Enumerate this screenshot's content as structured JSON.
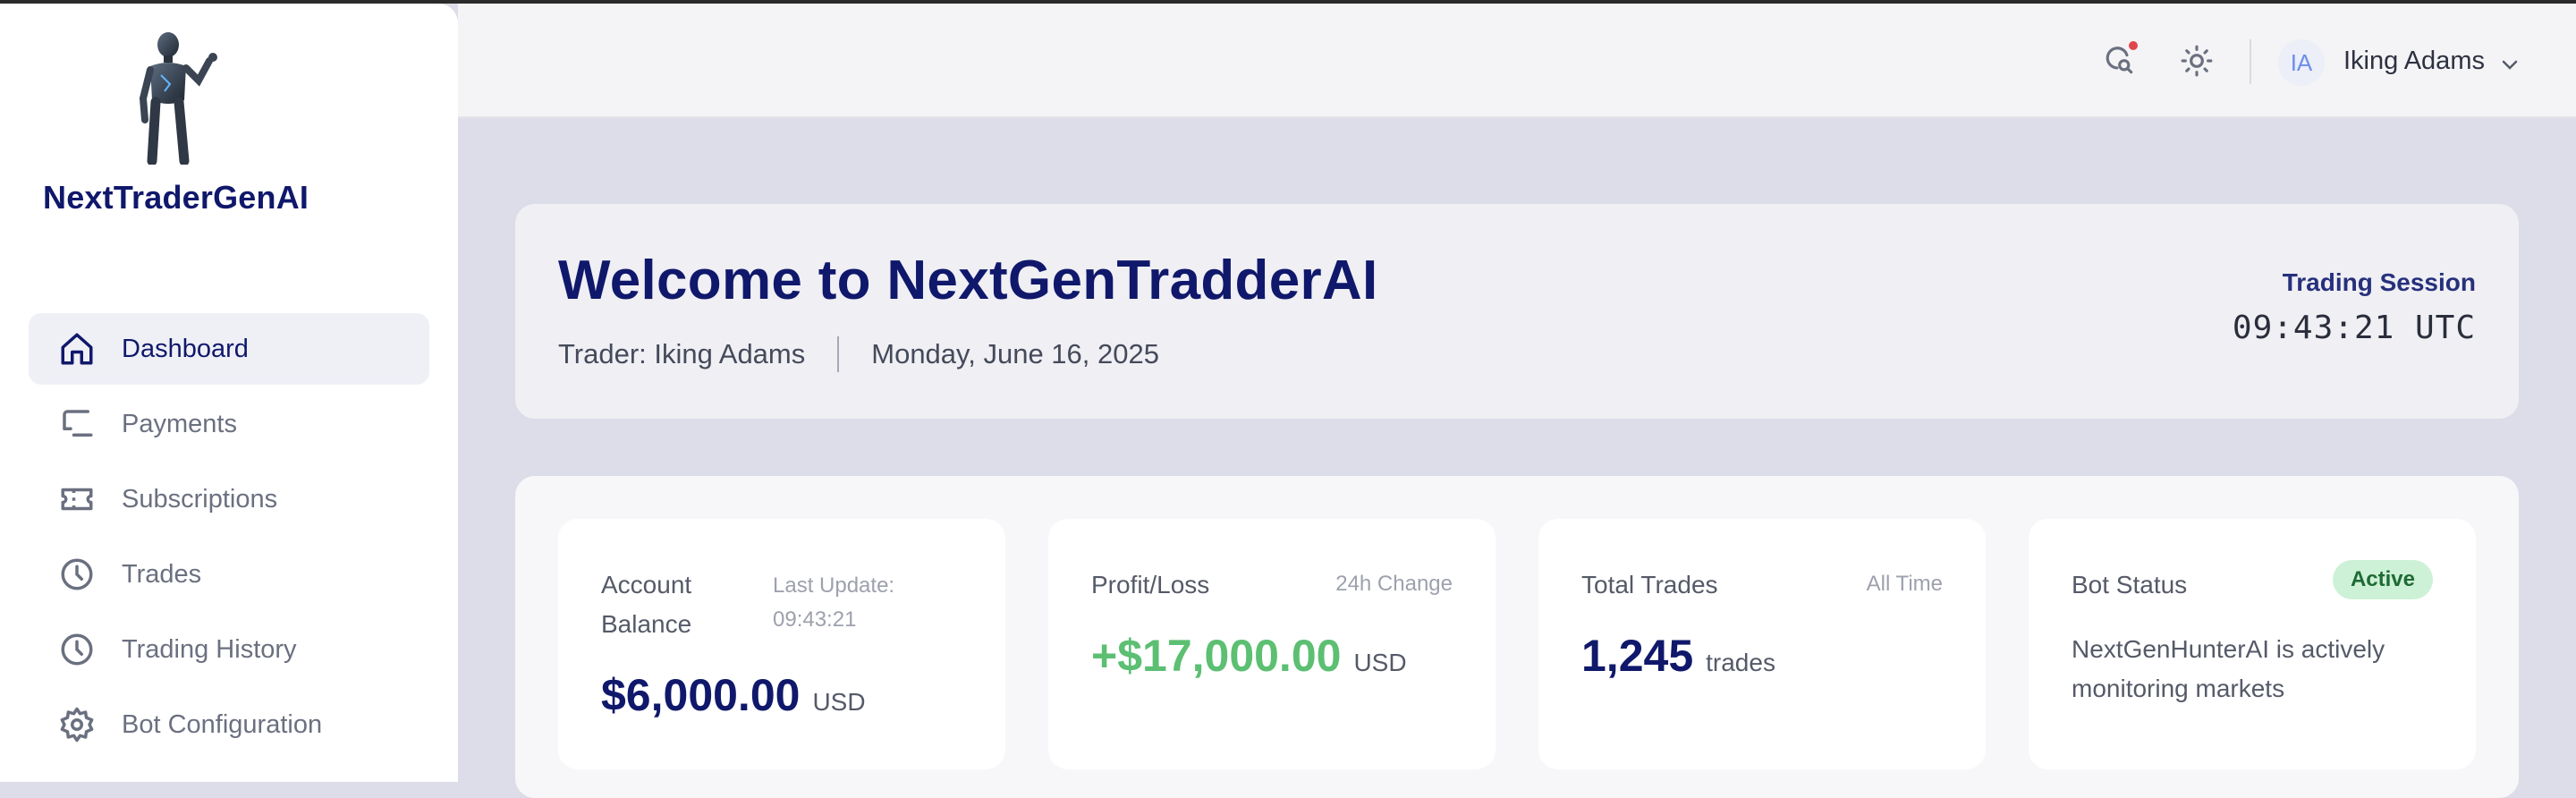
{
  "brand": {
    "name": "NextTraderGenAI"
  },
  "sidebar": {
    "items": [
      {
        "label": "Dashboard",
        "icon": "home-icon",
        "active": true
      },
      {
        "label": "Payments",
        "icon": "payments-icon"
      },
      {
        "label": "Subscriptions",
        "icon": "ticket-icon"
      },
      {
        "label": "Trades",
        "icon": "clock-icon"
      },
      {
        "label": "Trading History",
        "icon": "clock-icon"
      },
      {
        "label": "Bot Configuration",
        "icon": "gear-icon"
      }
    ]
  },
  "header": {
    "user": {
      "initials": "IA",
      "name": "Iking Adams"
    },
    "icons": [
      "notification-search-icon",
      "sun-icon",
      "chevron-down-icon"
    ],
    "notification_color": "#e0464b"
  },
  "welcome": {
    "title": "Welcome to NextGenTradderAI",
    "trader": "Trader: Iking Adams",
    "date": "Monday, June 16, 2025",
    "session_label": "Trading Session",
    "session_time": "09:43:21 UTC"
  },
  "stats": {
    "balance": {
      "title": "Account Balance",
      "meta": "Last Update: 09:43:21",
      "value": "$6,000.00",
      "unit": "USD"
    },
    "pnl": {
      "title": "Profit/Loss",
      "meta": "24h Change",
      "value": "+$17,000.00",
      "unit": "USD"
    },
    "trades": {
      "title": "Total Trades",
      "meta": "All Time",
      "value": "1,245",
      "unit": "trades"
    },
    "bot": {
      "title": "Bot Status",
      "badge": "Active",
      "description": "NextGenHunterAI is actively monitoring markets"
    }
  },
  "colors": {
    "brand": "#10186b",
    "positive": "#5cbf72",
    "badge_bg": "#cdf1d6"
  }
}
